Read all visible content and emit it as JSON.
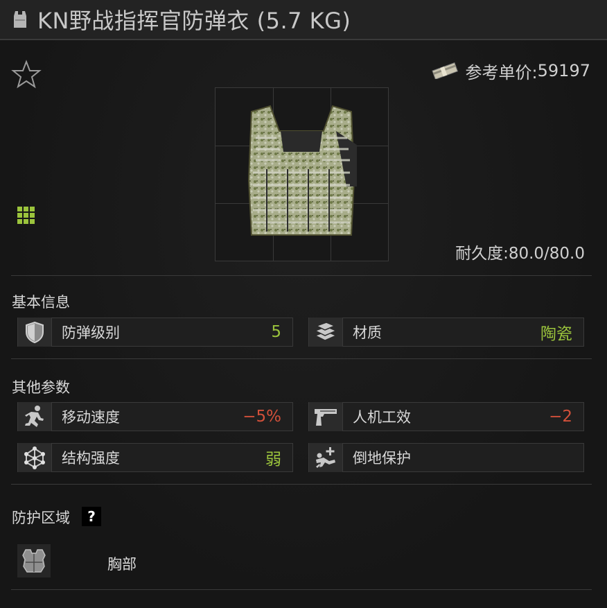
{
  "title": "KN野战指挥官防弹衣 (5.7 KG)",
  "price": {
    "label": "参考单价:",
    "value": "59197"
  },
  "durability": {
    "label": "耐久度:",
    "value": "80.0/80.0"
  },
  "basic": {
    "title": "基本信息",
    "armor_class": {
      "label": "防弹级别",
      "value": "5",
      "icon": "shield-icon"
    },
    "material": {
      "label": "材质",
      "value": "陶瓷",
      "icon": "ceramic-plates-icon"
    }
  },
  "other": {
    "title": "其他参数",
    "move_speed": {
      "label": "移动速度",
      "value": "−5%",
      "icon": "running-man-icon"
    },
    "ergonomics": {
      "label": "人机工效",
      "value": "−2",
      "icon": "pistol-icon"
    },
    "structure": {
      "label": "结构强度",
      "value": "弱",
      "icon": "molecule-icon"
    },
    "fall_protection": {
      "label": "倒地保护",
      "value": "",
      "icon": "fall-protection-icon"
    }
  },
  "protection": {
    "title": "防护区域",
    "help": "?",
    "zone": {
      "label": "胸部",
      "icon": "torso-armor-icon"
    }
  },
  "colors": {
    "positive": "#9bc43c",
    "negative": "#d2503a",
    "grid_icon": "#9bc43c"
  }
}
